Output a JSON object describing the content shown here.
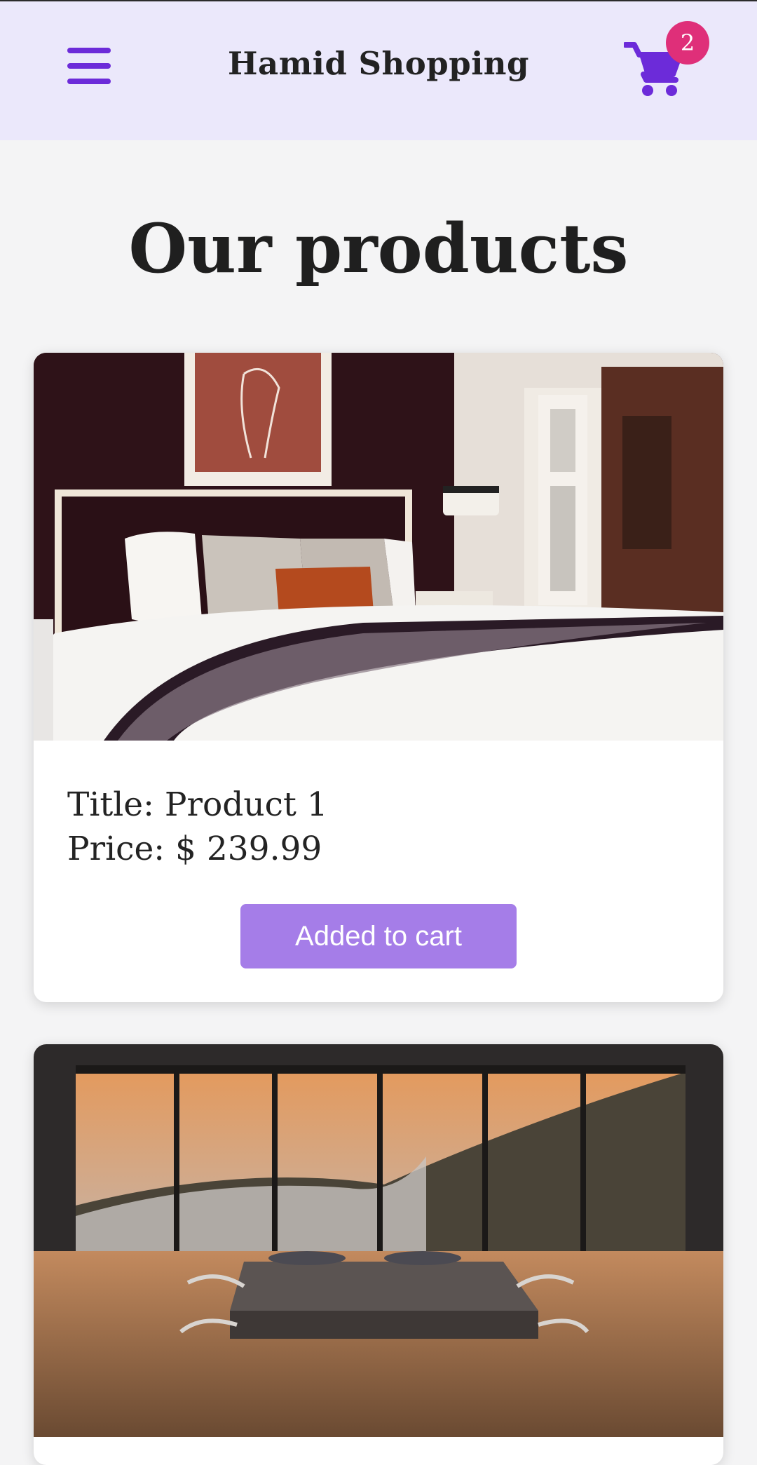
{
  "header": {
    "title": "Hamid Shopping",
    "menu_icon": "hamburger-menu-icon",
    "cart_icon": "shopping-cart-icon",
    "cart_count": "2",
    "accent_color": "#6c2bd9",
    "badge_color": "#df2f79"
  },
  "main": {
    "heading": "Our products",
    "products": [
      {
        "title_text": "Title: Product 1",
        "price_text": "Price: $ 239.99",
        "button_label": "Added to cart",
        "image": "hotel-bedroom-photo"
      },
      {
        "image": "mountain-view-bedroom-photo"
      }
    ]
  }
}
